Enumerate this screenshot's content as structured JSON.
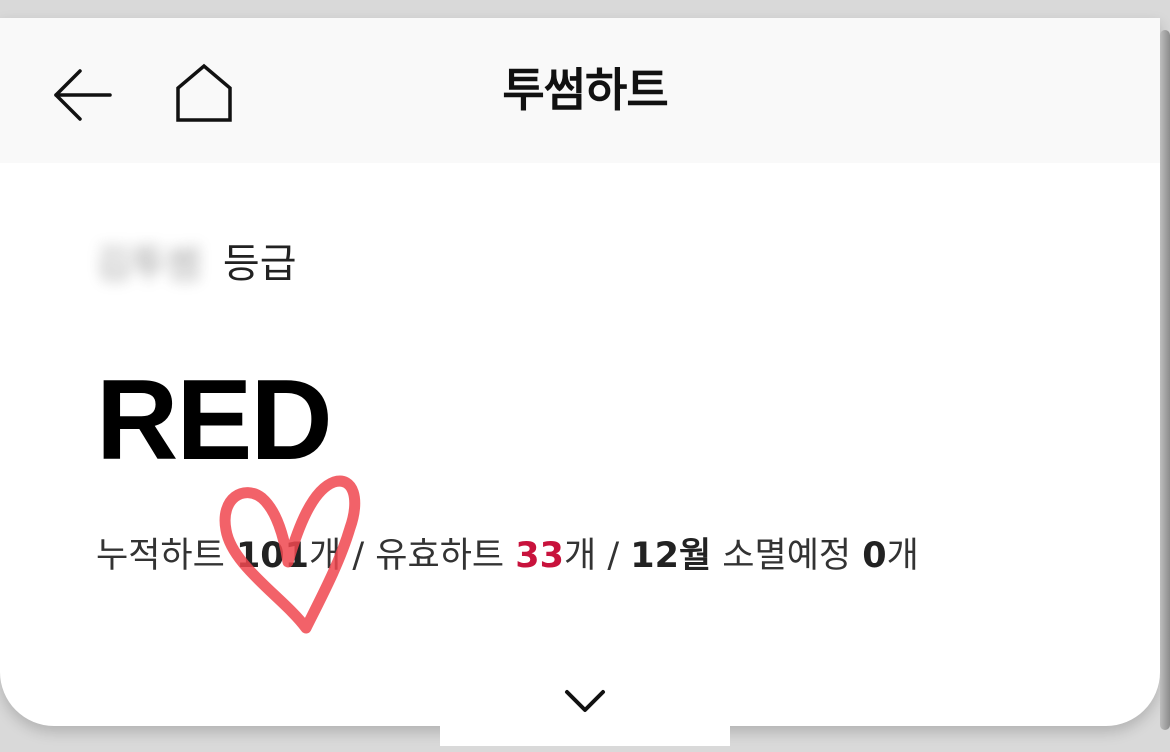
{
  "header": {
    "title": "투썸하트",
    "back_icon": "arrow-left-icon",
    "home_icon": "home-icon"
  },
  "grade": {
    "user_name": "김투썸",
    "label": "등급",
    "value": "RED"
  },
  "stats": {
    "accumulated_label": "누적하트",
    "accumulated_value": "101",
    "unit": "개",
    "separator": "/",
    "valid_label": "유효하트",
    "valid_value": "33",
    "month_value": "12월",
    "expiring_label": "소멸예정",
    "expiring_value": "0"
  },
  "footer": {
    "expand_icon": "chevron-down-icon"
  },
  "colors": {
    "accent": "#c8123c",
    "doodle": "#f0474f",
    "header_bg": "#f9f9f9"
  }
}
